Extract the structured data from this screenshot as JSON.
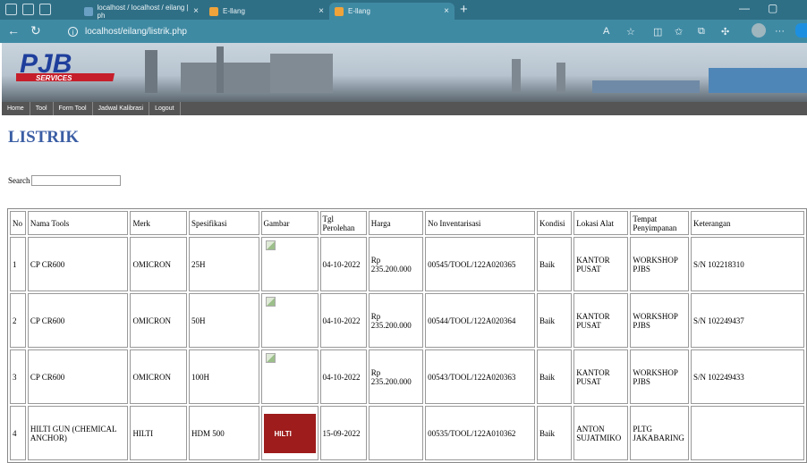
{
  "browser": {
    "tabs": [
      {
        "label": "localhost / localhost / eilang | ph"
      },
      {
        "label": "E-llang"
      },
      {
        "label": "E-llang"
      }
    ],
    "url": "localhost/eilang/listrik.php",
    "new_tab_glyph": "+"
  },
  "site": {
    "logo_text": "PJB",
    "logo_sub": "SERVICES",
    "menu": [
      "Home",
      "Tool",
      "Form Tool",
      "Jadwal Kalibrasi",
      "Logout"
    ]
  },
  "page": {
    "title": "LISTRIK",
    "search_label": "Search",
    "search_value": ""
  },
  "table": {
    "headers": [
      "No",
      "Nama Tools",
      "Merk",
      "Spesifikasi",
      "Gambar",
      "Tgl Perolehan",
      "Harga",
      "No Inventarisasi",
      "Kondisi",
      "Lokasi Alat",
      "Tempat Penyimpanan",
      "Keterangan"
    ],
    "rows": [
      {
        "no": "1",
        "nama": "CP CR600",
        "merk": "OMICRON",
        "spek": "25H",
        "gambar": "broken-image-icon",
        "tgl": "04-10-2022",
        "harga": "Rp 235.200.000",
        "inv": "00545/TOOL/122A020365",
        "kondisi": "Baik",
        "lokasi": "KANTOR PUSAT",
        "tempat": "WORKSHOP PJBS",
        "ket": "S/N 102218310"
      },
      {
        "no": "2",
        "nama": "CP CR600",
        "merk": "OMICRON",
        "spek": "50H",
        "gambar": "broken-image-icon",
        "tgl": "04-10-2022",
        "harga": "Rp 235.200.000",
        "inv": "00544/TOOL/122A020364",
        "kondisi": "Baik",
        "lokasi": "KANTOR PUSAT",
        "tempat": "WORKSHOP PJBS",
        "ket": "S/N 102249437"
      },
      {
        "no": "3",
        "nama": "CP CR600",
        "merk": "OMICRON",
        "spek": "100H",
        "gambar": "broken-image-icon",
        "tgl": "04-10-2022",
        "harga": "Rp 235.200.000",
        "inv": "00543/TOOL/122A020363",
        "kondisi": "Baik",
        "lokasi": "KANTOR PUSAT",
        "tempat": "WORKSHOP PJBS",
        "ket": "S/N 102249433"
      },
      {
        "no": "4",
        "nama": "HILTI GUN (CHEMICAL ANCHOR)",
        "merk": "HILTI",
        "spek": "HDM 500",
        "gambar": "hilti-case-photo",
        "photo_label": "HILTI",
        "tgl": "15-09-2022",
        "harga": "",
        "inv": "00535/TOOL/122A010362",
        "kondisi": "Baik",
        "lokasi": "ANTON SUJATMIKO",
        "tempat": "PLTG JAKABARING",
        "ket": ""
      }
    ]
  },
  "colors": {
    "title": "#3b5ea4",
    "menubar": "#555555",
    "browser_chrome": "#2f6f86"
  }
}
